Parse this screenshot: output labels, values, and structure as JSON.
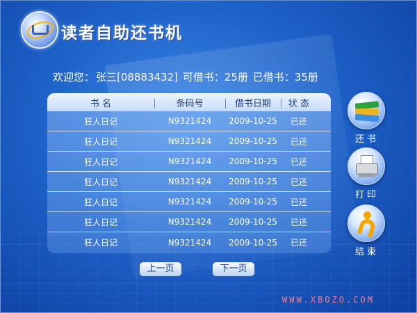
{
  "app": {
    "title": "读者自助还书机"
  },
  "welcome": {
    "greeting": "欢迎您：",
    "user": "张三[08883432]",
    "can_borrow": "可借书：25册",
    "borrowed": "已借书：35册"
  },
  "table": {
    "headers": [
      "书 名",
      "条码号",
      "借书日期",
      "状 态"
    ],
    "rows": [
      {
        "name": "狂人日记",
        "code": "N9321424",
        "date": "2009-10-25",
        "status": "已还"
      },
      {
        "name": "狂人日记",
        "code": "N9321424",
        "date": "2009-10-25",
        "status": "已还"
      },
      {
        "name": "狂人日记",
        "code": "N9321424",
        "date": "2009-10-25",
        "status": "已还"
      },
      {
        "name": "狂人日记",
        "code": "N9321424",
        "date": "2009-10-25",
        "status": "已还"
      },
      {
        "name": "狂人日记",
        "code": "N9321424",
        "date": "2009-10-25",
        "status": "已还"
      },
      {
        "name": "狂人日记",
        "code": "N9321424",
        "date": "2009-10-25",
        "status": "已还"
      },
      {
        "name": "狂人日记",
        "code": "N9321424",
        "date": "2009-10-25",
        "status": "已还"
      }
    ]
  },
  "actions": {
    "return_label": "还书",
    "return_icon": "books-icon",
    "print_label": "打印",
    "print_icon": "printer-icon",
    "exit_label": "结束",
    "exit_icon": "exit-figure-icon"
  },
  "pager": {
    "prev_label": "上一页",
    "next_label": "下一页"
  },
  "footer": {
    "site": "WWW.XBOZO.COM"
  },
  "colors": {
    "background": "#1e62c9",
    "header_bar": "#c6dbf8",
    "footer_text": "#ff7a8a"
  }
}
